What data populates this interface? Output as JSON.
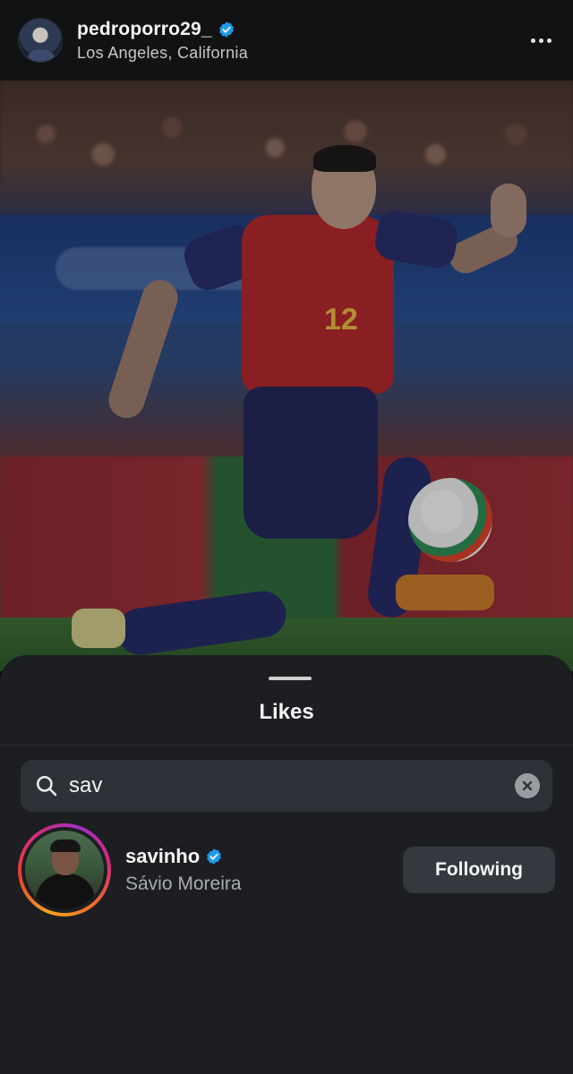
{
  "post": {
    "username": "pedroporro29_",
    "location": "Los Angeles, California",
    "verified": true,
    "photo": {
      "jersey_number": "12"
    }
  },
  "likes_sheet": {
    "title": "Likes",
    "search": {
      "value": "sav",
      "placeholder": "Search"
    },
    "results": [
      {
        "username": "savinho",
        "full_name": "Sávio Moreira",
        "verified": true,
        "has_story_ring": true,
        "button_label": "Following"
      }
    ]
  },
  "icons": {
    "verified": "verified-badge-icon",
    "more": "more-horizontal-icon",
    "search": "search-icon",
    "clear": "clear-icon"
  },
  "colors": {
    "verified_blue": "#1d9bf0",
    "sheet_background": "#1c1e21",
    "button_background": "#34383f"
  }
}
